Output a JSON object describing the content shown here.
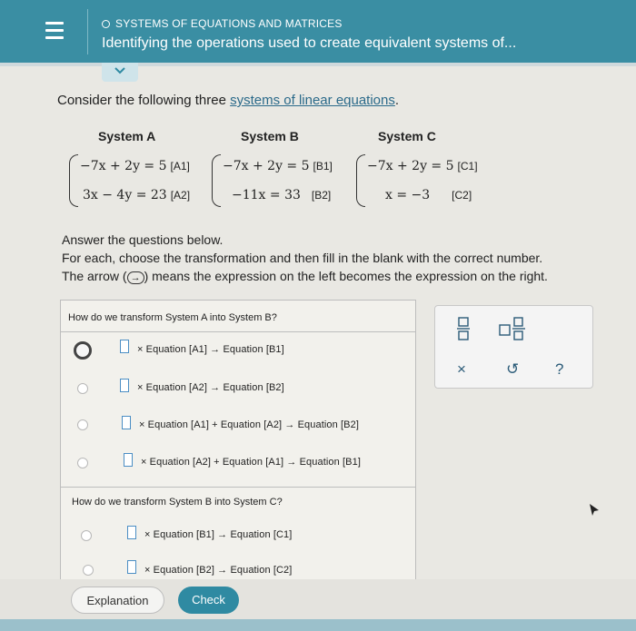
{
  "header": {
    "topic": "SYSTEMS OF EQUATIONS AND MATRICES",
    "lesson_title": "Identifying the operations used to create equivalent systems of..."
  },
  "prompt": {
    "before": "Consider the following three ",
    "link": "systems of linear equations",
    "after": "."
  },
  "systems": [
    {
      "title": "System A",
      "eq1": "−7x + 2y = 5",
      "tag1": "[A1]",
      "eq2": "3x − 4y = 23",
      "tag2": "[A2]"
    },
    {
      "title": "System B",
      "eq1": "−7x + 2y = 5",
      "tag1": "[B1]",
      "eq2": "−11x = 33",
      "tag2": "[B2]"
    },
    {
      "title": "System C",
      "eq1": "−7x + 2y = 5",
      "tag1": "[C1]",
      "eq2": "x = −3",
      "tag2": "[C2]"
    }
  ],
  "instructions": {
    "line1": "Answer the questions below.",
    "line2": "For each, choose the transformation and then fill in the blank with the correct number.",
    "line3_before": "The arrow (",
    "arrow": "→",
    "line3_after": ") means the expression on the left becomes the expression on the right."
  },
  "question1": {
    "prompt": "How do we transform System A into System B?",
    "options": [
      "× Equation [A1] → Equation [B1]",
      "× Equation [A2] → Equation [B2]",
      "× Equation [A1] + Equation [A2] → Equation [B2]",
      "× Equation [A2] + Equation [A1] → Equation [B1]"
    ]
  },
  "question2": {
    "prompt": "How do we transform System B into System C?",
    "options": [
      "× Equation [B1] → Equation [C1]",
      "× Equation [B2] → Equation [C2]"
    ]
  },
  "toolbox": {
    "clear": "×",
    "undo": "↺",
    "help": "?"
  },
  "buttons": {
    "explanation": "Explanation",
    "check": "Check"
  },
  "colors": {
    "header": "#3a8ea3",
    "link": "#2b6a8a",
    "check_button": "#2f8aa2",
    "blank_border": "#4b8ec4"
  }
}
